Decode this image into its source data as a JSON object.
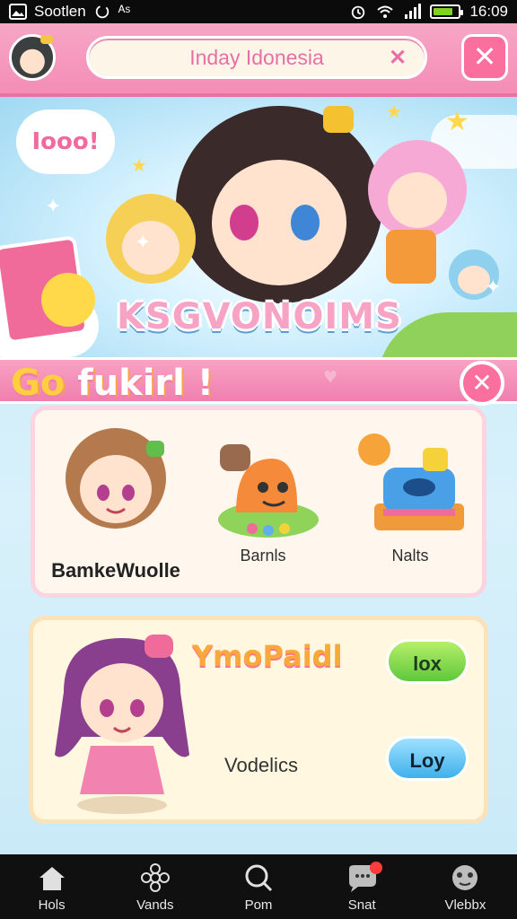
{
  "status_bar": {
    "left_text": "Sootlen",
    "left_symbol": "ᴬˢ",
    "time": "16:09",
    "colors": {
      "battery": "#7ed321"
    }
  },
  "header": {
    "search_value": "Inday Idonesia"
  },
  "hero": {
    "speech_text": "Iooo!",
    "title": "KSGVONOIMS"
  },
  "banner": {
    "title_prefix": "Go",
    "title_rest": " fukirl !"
  },
  "grid": {
    "items": [
      {
        "label": "BamkeWuolle",
        "icon": "girl-avatar-icon"
      },
      {
        "label": "Barnls",
        "icon": "slime-monster-icon"
      },
      {
        "label": "Nalts",
        "icon": "cash-register-icon"
      }
    ]
  },
  "featured": {
    "title": "YmoPaidl",
    "subtitle": "Vodelics",
    "button_primary": "lox",
    "button_secondary": "Loy"
  },
  "bottom_nav": {
    "items": [
      {
        "label": "Hols",
        "icon": "home-icon"
      },
      {
        "label": "Vands",
        "icon": "flower-icon"
      },
      {
        "label": "Pom",
        "icon": "search-icon"
      },
      {
        "label": "Snat",
        "icon": "chat-icon"
      },
      {
        "label": "Vlebbx",
        "icon": "globe-icon"
      }
    ]
  },
  "theme": {
    "pink": "#f48db6",
    "accent_pink": "#fb6f9e",
    "green": "#5fc83b",
    "blue": "#3fb0ea",
    "orange": "#f9a93b"
  }
}
